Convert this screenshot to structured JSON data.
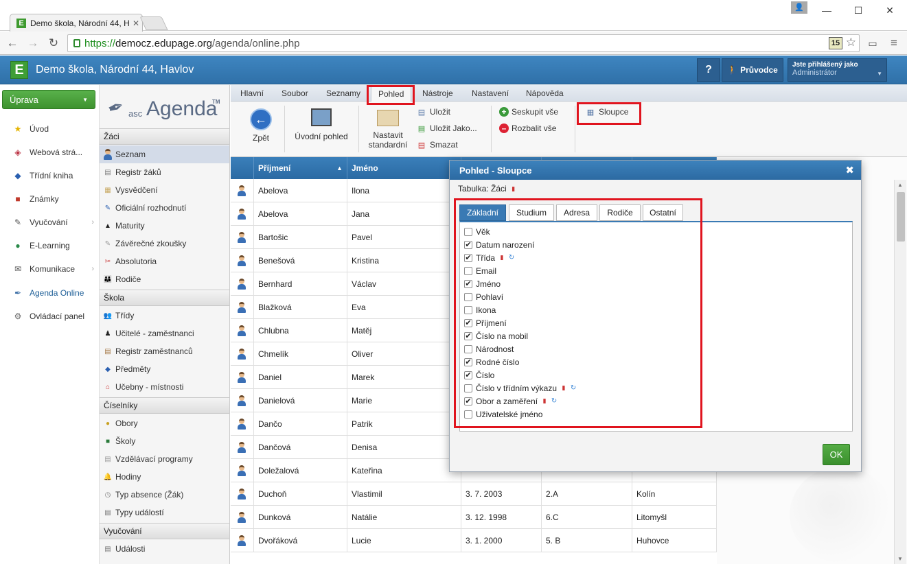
{
  "browser": {
    "tab_title": "Demo škola, Národní 44, H",
    "url_scheme": "https://",
    "url_domain": "democz.edupage.org",
    "url_path": "/agenda/online.php",
    "badge": "15"
  },
  "header": {
    "logo_letter": "E",
    "school_name": "Demo škola, Národní 44, Havlov",
    "help_label": "?",
    "guide_label": "Průvodce",
    "user_line1": "Jste přihlášený jako",
    "user_line2": "Administrátor"
  },
  "leftnav": {
    "edit_label": "Úprava",
    "items": [
      {
        "label": "Úvod",
        "icon": "star-icon"
      },
      {
        "label": "Webová strá...",
        "icon": "web-icon"
      },
      {
        "label": "Třídní kniha",
        "icon": "book-icon"
      },
      {
        "label": "Známky",
        "icon": "grades-icon"
      },
      {
        "label": "Vyučování",
        "icon": "teaching-icon"
      },
      {
        "label": "E-Learning",
        "icon": "elearning-icon"
      },
      {
        "label": "Komunikace",
        "icon": "communication-icon"
      },
      {
        "label": "Agenda Online",
        "icon": "agenda-icon"
      },
      {
        "label": "Ovládací panel",
        "icon": "control-panel-icon"
      }
    ]
  },
  "subnav": {
    "logo_asc": "asc",
    "logo_agenda": "Agenda",
    "logo_tm": "TM",
    "sections": [
      {
        "title": "Žáci",
        "items": [
          "Seznam",
          "Registr žáků",
          "Vysvědčení",
          "Oficiální rozhodnutí",
          "Maturity",
          "Závěrečné zkoušky",
          "Absolutoria",
          "Rodiče"
        ]
      },
      {
        "title": "Škola",
        "items": [
          "Třídy",
          "Učitelé - zaměstnanci",
          "Registr zaměstnanců",
          "Předměty",
          "Učebny - místnosti"
        ]
      },
      {
        "title": "Číselníky",
        "items": [
          "Obory",
          "Školy",
          "Vzdělávací programy",
          "Hodiny",
          "Typ absence (Žák)",
          "Typy událostí"
        ]
      },
      {
        "title": "Vyučování",
        "items": [
          "Události"
        ]
      }
    ]
  },
  "ribbon": {
    "menu": [
      "Hlavní",
      "Soubor",
      "Seznamy",
      "Pohled",
      "Nástroje",
      "Nastavení",
      "Nápověda"
    ],
    "back": "Zpět",
    "home_view": "Úvodní pohled",
    "set_default_1": "Nastavit",
    "set_default_2": "standardní",
    "save": "Uložit",
    "save_as": "Uložit Jako...",
    "delete": "Smazat",
    "group_all": "Seskupit vše",
    "expand_all": "Rozbalit vše",
    "columns": "Sloupce"
  },
  "grid": {
    "headers": [
      "Příjmení",
      "Jméno"
    ],
    "rows": [
      [
        "Abelova",
        "Ilona",
        "",
        "",
        ""
      ],
      [
        "Abelova",
        "Jana",
        "",
        "",
        ""
      ],
      [
        "Bartošic",
        "Pavel",
        "",
        "",
        ""
      ],
      [
        "Benešová",
        "Kristina",
        "",
        "",
        ""
      ],
      [
        "Bernhard",
        "Václav",
        "",
        "",
        ""
      ],
      [
        "Blažková",
        "Eva",
        "",
        "",
        ""
      ],
      [
        "Chlubna",
        "Matěj",
        "",
        "",
        ""
      ],
      [
        "Chmelík",
        "Oliver",
        "",
        "",
        ""
      ],
      [
        "Daniel",
        "Marek",
        "",
        "",
        ""
      ],
      [
        "Danielová",
        "Marie",
        "",
        "",
        ""
      ],
      [
        "Dančo",
        "Patrik",
        "",
        "",
        ""
      ],
      [
        "Dančová",
        "Denisa",
        "",
        "",
        ""
      ],
      [
        "Doležalová",
        "Kateřina",
        "",
        "",
        ""
      ],
      [
        "Duchoň",
        "Vlastimil",
        "3. 7. 2003",
        "2.A",
        "Kolín"
      ],
      [
        "Dunková",
        "Natálie",
        "3. 12. 1998",
        "6.C",
        "Litomyšl"
      ],
      [
        "Dvořáková",
        "Lucie",
        "3. 1. 2000",
        "5. B",
        "Huhovce"
      ]
    ]
  },
  "dialog": {
    "title": "Pohled - Sloupce",
    "table_label": "Tabulka: Žáci",
    "tabs": [
      "Základní",
      "Studium",
      "Adresa",
      "Rodiče",
      "Ostatní"
    ],
    "options": [
      {
        "label": "Věk",
        "checked": false,
        "icons": false
      },
      {
        "label": "Datum narození",
        "checked": true,
        "icons": false
      },
      {
        "label": "Třída",
        "checked": true,
        "icons": true
      },
      {
        "label": "Email",
        "checked": false,
        "icons": false
      },
      {
        "label": "Jméno",
        "checked": true,
        "icons": false
      },
      {
        "label": "Pohlaví",
        "checked": false,
        "icons": false
      },
      {
        "label": "Ikona",
        "checked": false,
        "icons": false
      },
      {
        "label": "Příjmení",
        "checked": true,
        "icons": false
      },
      {
        "label": "Číslo na mobil",
        "checked": true,
        "icons": false
      },
      {
        "label": "Národnost",
        "checked": false,
        "icons": false
      },
      {
        "label": "Rodné číslo",
        "checked": true,
        "icons": false
      },
      {
        "label": "Číslo",
        "checked": true,
        "icons": false
      },
      {
        "label": "Číslo v třídním výkazu",
        "checked": false,
        "icons": true
      },
      {
        "label": "Obor a zaměření",
        "checked": true,
        "icons": true
      },
      {
        "label": "Uživatelské jméno",
        "checked": false,
        "icons": false
      }
    ],
    "ok": "OK"
  }
}
